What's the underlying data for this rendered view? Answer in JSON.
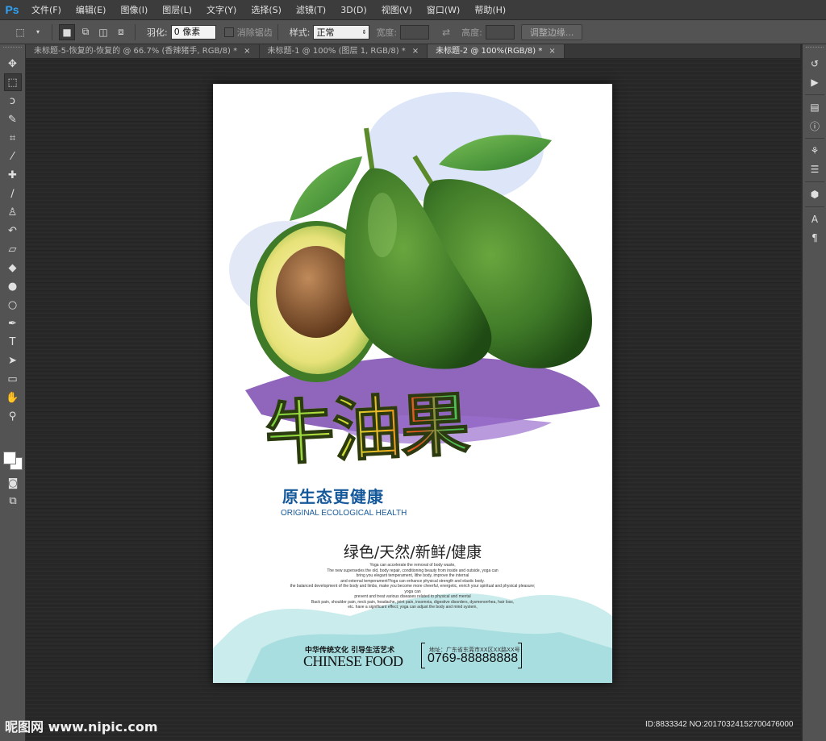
{
  "app": {
    "logo": "Ps"
  },
  "menu": [
    "文件(F)",
    "编辑(E)",
    "图像(I)",
    "图层(L)",
    "文字(Y)",
    "选择(S)",
    "滤镜(T)",
    "3D(D)",
    "视图(V)",
    "窗口(W)",
    "帮助(H)"
  ],
  "options": {
    "feather_label": "羽化:",
    "feather_value": "0 像素",
    "antialias_label": "消除锯齿",
    "style_label": "样式:",
    "style_value": "正常",
    "width_label": "宽度:",
    "height_label": "高度:",
    "refine_button": "调整边缘..."
  },
  "tabs": [
    {
      "label": "未标题-5-恢复的-恢复的 @ 66.7% (香辣猪手, RGB/8) *",
      "close": "×"
    },
    {
      "label": "未标题-1 @ 100% (图层 1, RGB/8) *",
      "close": "×"
    },
    {
      "label": "未标题-2 @ 100%(RGB/8) *",
      "close": "×"
    }
  ],
  "poster": {
    "title": "牛油果",
    "slogan_cn": "原生态更健康",
    "slogan_en": "ORIGINAL ECOLOGICAL HEALTH",
    "tagline": "绿色/天然/新鲜/健康",
    "small_lines": [
      "Yoga can accelerate the removal of body waste,",
      "The new supersedes the old, body repair, conditioning beauty from inside and outside, yoga can",
      "bring you elegant temperament, lithe body, improve the internal",
      "and external temperament!Yoga can enhance physical strength and elastic body.",
      "the balanced development of the body and limbs, make you become more cheerful, energetic, enrich your spiritual and physical pleasure; yoga can",
      "prevent and treat various diseases related to physical and mental",
      "Back pain, shoulder pain, neck pain, headache, joint pain, insomnia, digestive disorders, dysmenorrhea, hair loss,",
      "etc. have a significant effect; yoga can adjust the body and mind system,"
    ],
    "brand_cn": "中华传统文化 引导生活艺术",
    "brand_en": "CHINESE FOOD",
    "address": "地址：广东省东莞市XX区XX路XX号",
    "phone": "0769-88888888"
  },
  "watermark": {
    "left": "昵图网 www.nipic.com",
    "right": "ID:8833342 NO:20170324152700476000"
  },
  "colors": {
    "ps_blue": "#2fa3f6",
    "slogan_blue": "#16599b",
    "avocado_green": "#3f7a28",
    "purple_splash": "#7b4bb0"
  }
}
